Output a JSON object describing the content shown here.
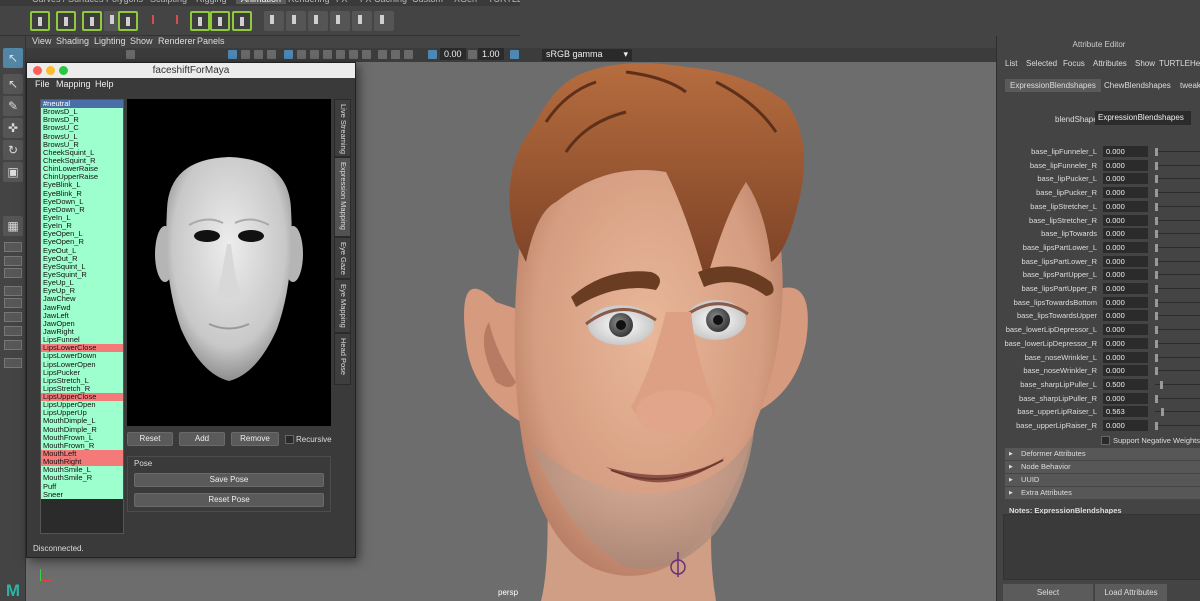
{
  "shelf": {
    "tabs": [
      "Curves / Surfaces",
      "Polygons",
      "Sculpting",
      "Rigging",
      "Animation",
      "Rendering",
      "FX",
      "FX Caching",
      "Custom",
      "XGen",
      "TURTLE"
    ],
    "active_tab": "Animation"
  },
  "viewport": {
    "menu": [
      "View",
      "Shading",
      "Lighting",
      "Show",
      "Renderer",
      "Panels"
    ],
    "exposure": "0.00",
    "gamma": "1.00",
    "color_space": "sRGB gamma",
    "camera_label": "persp"
  },
  "faceshift": {
    "title": "faceshiftForMaya",
    "menu": [
      "File",
      "Mapping",
      "Help"
    ],
    "blendshapes": [
      {
        "name": "#neutral",
        "state": "selected"
      },
      {
        "name": "BrowsD_L",
        "state": "mapped"
      },
      {
        "name": "BrowsD_R",
        "state": "mapped"
      },
      {
        "name": "BrowsU_C",
        "state": "mapped"
      },
      {
        "name": "BrowsU_L",
        "state": "mapped"
      },
      {
        "name": "BrowsU_R",
        "state": "mapped"
      },
      {
        "name": "CheekSquint_L",
        "state": "mapped"
      },
      {
        "name": "CheekSquint_R",
        "state": "mapped"
      },
      {
        "name": "ChinLowerRaise",
        "state": "mapped"
      },
      {
        "name": "ChinUpperRaise",
        "state": "mapped"
      },
      {
        "name": "EyeBlink_L",
        "state": "mapped"
      },
      {
        "name": "EyeBlink_R",
        "state": "mapped"
      },
      {
        "name": "EyeDown_L",
        "state": "mapped"
      },
      {
        "name": "EyeDown_R",
        "state": "mapped"
      },
      {
        "name": "EyeIn_L",
        "state": "mapped"
      },
      {
        "name": "EyeIn_R",
        "state": "mapped"
      },
      {
        "name": "EyeOpen_L",
        "state": "mapped"
      },
      {
        "name": "EyeOpen_R",
        "state": "mapped"
      },
      {
        "name": "EyeOut_L",
        "state": "mapped"
      },
      {
        "name": "EyeOut_R",
        "state": "mapped"
      },
      {
        "name": "EyeSquint_L",
        "state": "mapped"
      },
      {
        "name": "EyeSquint_R",
        "state": "mapped"
      },
      {
        "name": "EyeUp_L",
        "state": "mapped"
      },
      {
        "name": "EyeUp_R",
        "state": "mapped"
      },
      {
        "name": "JawChew",
        "state": "mapped"
      },
      {
        "name": "JawFwd",
        "state": "mapped"
      },
      {
        "name": "JawLeft",
        "state": "mapped"
      },
      {
        "name": "JawOpen",
        "state": "mapped"
      },
      {
        "name": "JawRight",
        "state": "mapped"
      },
      {
        "name": "LipsFunnel",
        "state": "mapped"
      },
      {
        "name": "LipsLowerClose",
        "state": "unmapped"
      },
      {
        "name": "LipsLowerDown",
        "state": "mapped"
      },
      {
        "name": "LipsLowerOpen",
        "state": "mapped"
      },
      {
        "name": "LipsPucker",
        "state": "mapped"
      },
      {
        "name": "LipsStretch_L",
        "state": "mapped"
      },
      {
        "name": "LipsStretch_R",
        "state": "mapped"
      },
      {
        "name": "LipsUpperClose",
        "state": "unmapped"
      },
      {
        "name": "LipsUpperOpen",
        "state": "mapped"
      },
      {
        "name": "LipsUpperUp",
        "state": "mapped"
      },
      {
        "name": "MouthDimple_L",
        "state": "mapped"
      },
      {
        "name": "MouthDimple_R",
        "state": "mapped"
      },
      {
        "name": "MouthFrown_L",
        "state": "mapped"
      },
      {
        "name": "MouthFrown_R",
        "state": "mapped"
      },
      {
        "name": "MouthLeft",
        "state": "unmapped"
      },
      {
        "name": "MouthRight",
        "state": "unmapped"
      },
      {
        "name": "MouthSmile_L",
        "state": "mapped"
      },
      {
        "name": "MouthSmile_R",
        "state": "mapped"
      },
      {
        "name": "Puff",
        "state": "mapped"
      },
      {
        "name": "Sneer",
        "state": "mapped"
      }
    ],
    "buttons": {
      "reset": "Reset",
      "add": "Add",
      "remove": "Remove",
      "recursive": "Recursive"
    },
    "pose": {
      "label": "Pose",
      "save": "Save Pose",
      "reset": "Reset Pose"
    },
    "side_tabs": [
      "Live Streaming",
      "Expression Mapping",
      "Eye Gaze",
      "Eye Mapping",
      "Head Pose"
    ],
    "active_side_tab": "Expression Mapping",
    "status": "Disconnected."
  },
  "attribute_editor": {
    "title": "Attribute Editor",
    "menu": [
      "List",
      "Selected",
      "Focus",
      "Attributes",
      "Show",
      "TURTLE",
      "He"
    ],
    "tabs": [
      "ExpressionBlendshapes",
      "ChewBlendshapes",
      "tweak"
    ],
    "active_tab": "ExpressionBlendshapes",
    "blendshape_label": "blendShape:",
    "blendshape_value": "ExpressionBlendshapes",
    "weights": [
      {
        "name": "base_lipFunneler_L",
        "value": "0.000",
        "level": 0.0
      },
      {
        "name": "base_lipFunneler_R",
        "value": "0.000",
        "level": 0.0
      },
      {
        "name": "base_lipPucker_L",
        "value": "0.000",
        "level": 0.0
      },
      {
        "name": "base_lipPucker_R",
        "value": "0.000",
        "level": 0.0
      },
      {
        "name": "base_lipStretcher_L",
        "value": "0.000",
        "level": 0.0
      },
      {
        "name": "base_lipStretcher_R",
        "value": "0.000",
        "level": 0.0
      },
      {
        "name": "base_lipTowards",
        "value": "0.000",
        "level": 0.0
      },
      {
        "name": "base_lipsPartLower_L",
        "value": "0.000",
        "level": 0.0
      },
      {
        "name": "base_lipsPartLower_R",
        "value": "0.000",
        "level": 0.0
      },
      {
        "name": "base_lipsPartUpper_L",
        "value": "0.000",
        "level": 0.0
      },
      {
        "name": "base_lipsPartUpper_R",
        "value": "0.000",
        "level": 0.0
      },
      {
        "name": "base_lipsTowardsBottom",
        "value": "0.000",
        "level": 0.0
      },
      {
        "name": "base_lipsTowardsUpper",
        "value": "0.000",
        "level": 0.0
      },
      {
        "name": "base_lowerLipDepressor_L",
        "value": "0.000",
        "level": 0.0
      },
      {
        "name": "base_lowerLipDepressor_R",
        "value": "0.000",
        "level": 0.0
      },
      {
        "name": "base_noseWrinkler_L",
        "value": "0.000",
        "level": 0.0
      },
      {
        "name": "base_noseWrinkler_R",
        "value": "0.000",
        "level": 0.0
      },
      {
        "name": "base_sharpLipPuller_L",
        "value": "0.500",
        "level": 0.5
      },
      {
        "name": "base_sharpLipPuller_R",
        "value": "0.000",
        "level": 0.0
      },
      {
        "name": "base_upperLipRaiser_L",
        "value": "0.563",
        "level": 0.563
      },
      {
        "name": "base_upperLipRaiser_R",
        "value": "0.000",
        "level": 0.0
      }
    ],
    "support_negative": "Support Negative Weights",
    "sections": [
      "Deformer Attributes",
      "Node Behavior",
      "UUID",
      "Extra Attributes"
    ],
    "notes_label": "Notes:  ExpressionBlendshapes",
    "select_button": "Select",
    "load_button": "Load Attributes"
  },
  "colors": {
    "mapped": "#9effce",
    "unmapped": "#f47a7a",
    "selected": "#4a6fa8",
    "shelf_accent": "#8fca3a",
    "viewport_bg": "#6d6d6d"
  }
}
